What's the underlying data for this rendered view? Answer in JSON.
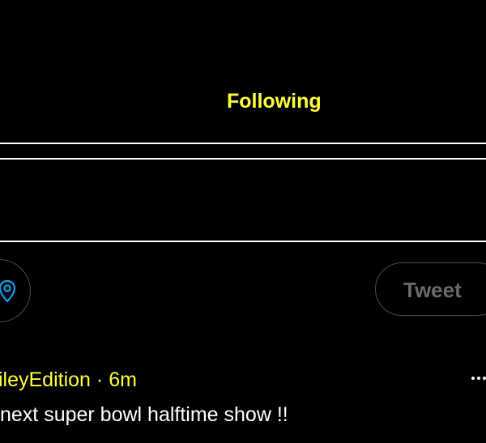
{
  "header": {
    "tab_following": "Following"
  },
  "composer": {
    "location_icon": "location-pin-icon",
    "tweet_button_label": "Tweet"
  },
  "post": {
    "author": "ileyEdition",
    "separator": "·",
    "time": "6m",
    "text": "next super bowl halftime show !!",
    "more_icon": "more-horizontal-icon"
  },
  "colors": {
    "accent": "#FFFF3B",
    "background": "#000000",
    "divider": "#FFFFFF",
    "disabled_text": "#6A6A6A",
    "icon_blue": "#1D9BF0"
  }
}
